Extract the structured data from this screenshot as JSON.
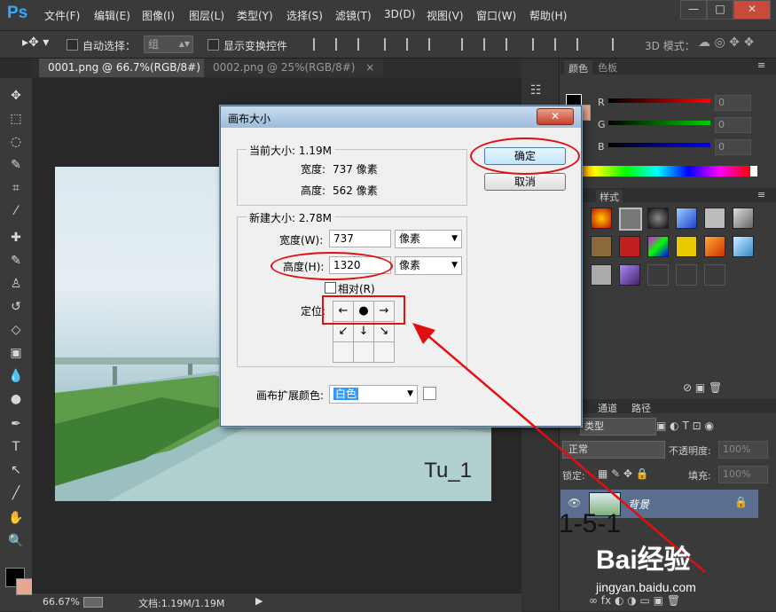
{
  "app": {
    "logo": "Ps"
  },
  "menu": [
    "文件(F)",
    "编辑(E)",
    "图像(I)",
    "图层(L)",
    "类型(Y)",
    "选择(S)",
    "滤镜(T)",
    "3D(D)",
    "视图(V)",
    "窗口(W)",
    "帮助(H)"
  ],
  "window_controls": {
    "minimize": "—",
    "maximize": "□",
    "close": "✕"
  },
  "options_bar": {
    "auto_select_label": "自动选择：",
    "auto_select_value": "组",
    "show_transform_label": "显示变换控件",
    "mode_3d_label": "3D 模式："
  },
  "tabs": [
    {
      "label": "0001.png @ 66.7%(RGB/8#)",
      "close": "×",
      "active": true
    },
    {
      "label": "0002.png @ 25%(RGB/8#)",
      "close": "×",
      "active": false
    }
  ],
  "tools": [
    "move-tool",
    "marquee-tool",
    "lasso-tool",
    "quick-select-tool",
    "crop-tool",
    "eyedropper-tool",
    "healing-tool",
    "brush-tool",
    "stamp-tool",
    "history-brush-tool",
    "eraser-tool",
    "gradient-tool",
    "blur-tool",
    "dodge-tool",
    "pen-tool",
    "type-tool",
    "path-select-tool",
    "line-tool",
    "hand-tool",
    "zoom-tool"
  ],
  "tool_glyphs": [
    "✥",
    "⬚",
    "◌",
    "✎",
    "⌗",
    "⁄",
    "✚",
    "✎",
    "♙",
    "↺",
    "◇",
    "▣",
    "💧",
    "●",
    "✒",
    "T",
    "↖",
    "╱",
    "✋",
    "🔍"
  ],
  "canvas": {
    "photo_label": "Tu_1"
  },
  "status": {
    "zoom": "66.67%",
    "doc_info": "文档:1.19M/1.19M"
  },
  "color_panel": {
    "tabs": [
      "颜色",
      "色板"
    ],
    "channels": [
      {
        "label": "R",
        "value": "0",
        "color": "#ff0000"
      },
      {
        "label": "G",
        "value": "0",
        "color": "#00d000"
      },
      {
        "label": "B",
        "value": "0",
        "color": "#0000ff"
      }
    ]
  },
  "styles_panel": {
    "tab": "样式"
  },
  "layers_panel": {
    "tabs": [
      "通道",
      "路径"
    ],
    "filter_label": "类型",
    "blend_mode": "正常",
    "opacity_label": "不透明度:",
    "opacity_value": "100%",
    "lock_label": "锁定:",
    "fill_label": "填充:",
    "fill_value": "100%",
    "layer_name": "背景"
  },
  "dialog": {
    "title": "画布大小",
    "close": "✕",
    "current_size_label": "当前大小: 1.19M",
    "width_label": "宽度:",
    "width_value": "737 像素",
    "height_label": "高度:",
    "height_value": "562 像素",
    "new_size_label": "新建大小: 2.78M",
    "new_width_label": "宽度(W):",
    "new_width_value": "737",
    "new_height_label": "高度(H):",
    "new_height_value": "1320",
    "unit": "像素",
    "relative_label": "相对(R)",
    "anchor_label": "定位:",
    "anchor_cells": [
      "←",
      "●",
      "→",
      "↙",
      "↓",
      "↘",
      "",
      "",
      ""
    ],
    "ext_color_label": "画布扩展颜色:",
    "ext_color_value": "白色",
    "ok_label": "确定",
    "cancel_label": "取消"
  },
  "annotation": {
    "step_label": "1-5-1"
  },
  "watermark": {
    "brand": "Bai经验",
    "url": "jingyan.baidu.com"
  }
}
